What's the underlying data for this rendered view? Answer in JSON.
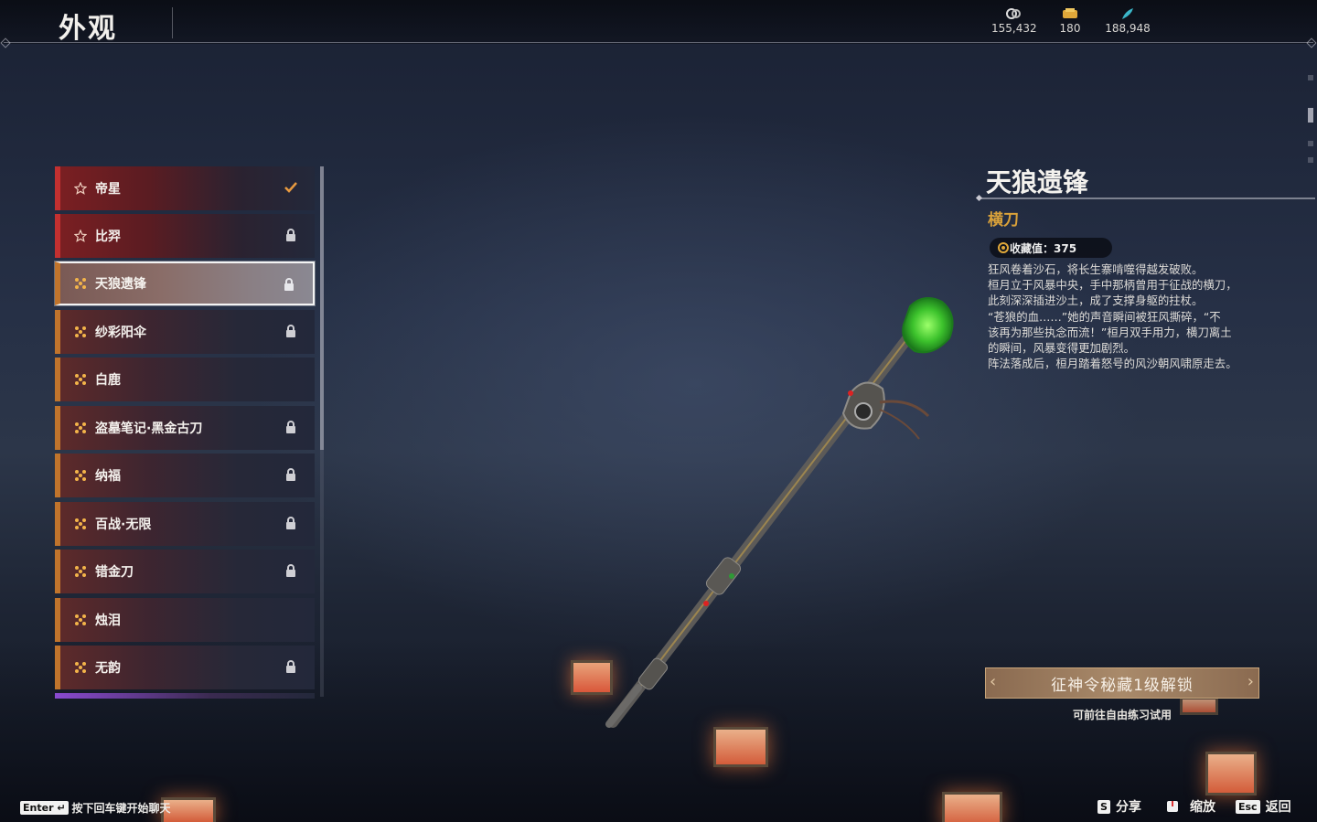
{
  "header": {
    "title": "外观"
  },
  "currencies": [
    {
      "icon": "coin-icon",
      "value": "155,432"
    },
    {
      "icon": "ticket-icon",
      "value": "180"
    },
    {
      "icon": "feather-icon",
      "value": "188,948"
    }
  ],
  "list": {
    "items": [
      {
        "label": "帝星",
        "icon": "star-icon",
        "state": "check"
      },
      {
        "label": "比羿",
        "icon": "star-icon",
        "state": "lock"
      },
      {
        "label": "天狼遗锋",
        "icon": "dots-icon",
        "state": "lock"
      },
      {
        "label": "纱彩阳伞",
        "icon": "dots-icon",
        "state": "lock"
      },
      {
        "label": "白鹿",
        "icon": "dots-icon",
        "state": "none"
      },
      {
        "label": "盗墓笔记·黑金古刀",
        "icon": "dots-icon",
        "state": "lock"
      },
      {
        "label": "纳福",
        "icon": "dots-icon",
        "state": "lock"
      },
      {
        "label": "百战·无限",
        "icon": "dots-icon",
        "state": "lock"
      },
      {
        "label": "错金刀",
        "icon": "dots-icon",
        "state": "lock"
      },
      {
        "label": "烛泪",
        "icon": "dots-icon",
        "state": "none"
      },
      {
        "label": "无韵",
        "icon": "dots-icon",
        "state": "lock"
      }
    ]
  },
  "detail": {
    "name": "天狼遗锋",
    "type": "横刀",
    "collection_label": "收藏值：375",
    "description_lines": [
      "狂风卷着沙石，将长生寨啃噬得越发破败。",
      "桓月立于风暴中央，手中那柄曾用于征战的横刀，",
      "此刻深深插进沙土，成了支撑身躯的拄杖。",
      "“苍狼的血……”她的声音瞬间被狂风撕碎，“不",
      "该再为那些执念而流！”桓月双手用力，横刀离土",
      "的瞬间，风暴变得更加剧烈。",
      "阵法落成后，桓月踏着怒号的风沙朝风啸原走去。"
    ],
    "unlock_button": "征神令秘藏1级解锁",
    "unlock_hint": "可前往自由练习试用"
  },
  "footer": {
    "chat_key": "Enter",
    "chat_hint": "按下回车键开始聊天",
    "share_key": "S",
    "share_label": "分享",
    "zoom_label": "缩放",
    "back_key": "Esc",
    "back_label": "返回"
  },
  "colors": {
    "accent_orange": "#c0742c",
    "accent_red": "#c23030",
    "gold_text": "#d9a13a",
    "jade": "#3fc33a"
  }
}
